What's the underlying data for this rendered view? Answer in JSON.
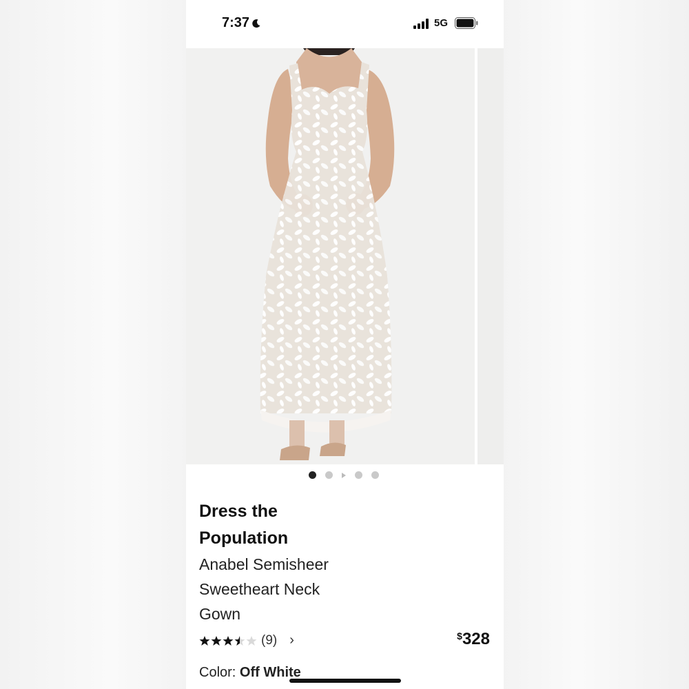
{
  "status_bar": {
    "time": "7:37",
    "network": "5G"
  },
  "product": {
    "brand_line1": "Dress the",
    "brand_line2": "Population",
    "title_line1": "Anabel Semisheer",
    "title_line2": "Sweetheart Neck",
    "title_line3": "Gown",
    "rating": 3.5,
    "rating_max": 5,
    "review_count": "(9)",
    "price_symbol": "$",
    "price_value": "328",
    "color_label": "Color:",
    "color_value": "Off White"
  },
  "gallery": {
    "image_count": 5,
    "active_index": 0
  },
  "colors": {
    "accent": "#111111",
    "background": "#ffffff",
    "dot_inactive": "#c9c9c9"
  }
}
